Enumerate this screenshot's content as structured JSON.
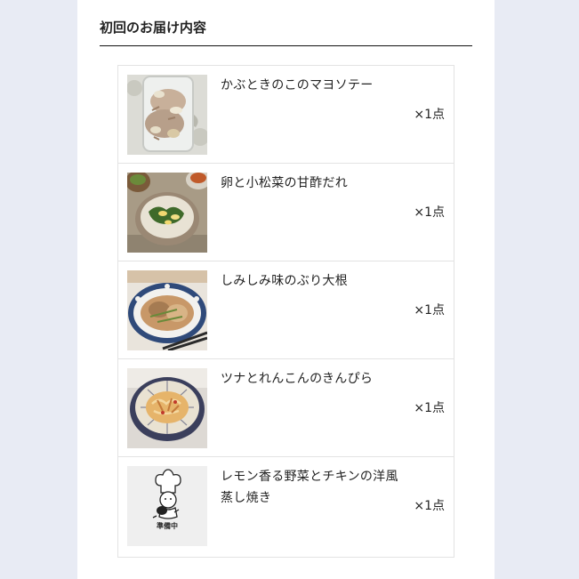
{
  "section": {
    "title": "初回のお届け内容"
  },
  "items": [
    {
      "name": "かぶときのこのマヨソテー",
      "qty": "×1点",
      "image_icon": "food-photo-icon"
    },
    {
      "name": "卵と小松菜の甘酢だれ",
      "qty": "×1点",
      "image_icon": "food-photo-icon"
    },
    {
      "name": "しみしみ味のぶり大根",
      "qty": "×1点",
      "image_icon": "food-photo-icon"
    },
    {
      "name": "ツナとれんこんのきんぴら",
      "qty": "×1点",
      "image_icon": "food-photo-icon"
    },
    {
      "name": "レモン香る野菜とチキンの洋風蒸し焼き",
      "qty": "×1点",
      "image_icon": "chef-illustration-icon",
      "image_label": "準備中"
    }
  ],
  "colors": {
    "page_background": "#e8ebf4",
    "panel_background": "#ffffff",
    "border": "#e3e3e3",
    "text": "#222222"
  }
}
